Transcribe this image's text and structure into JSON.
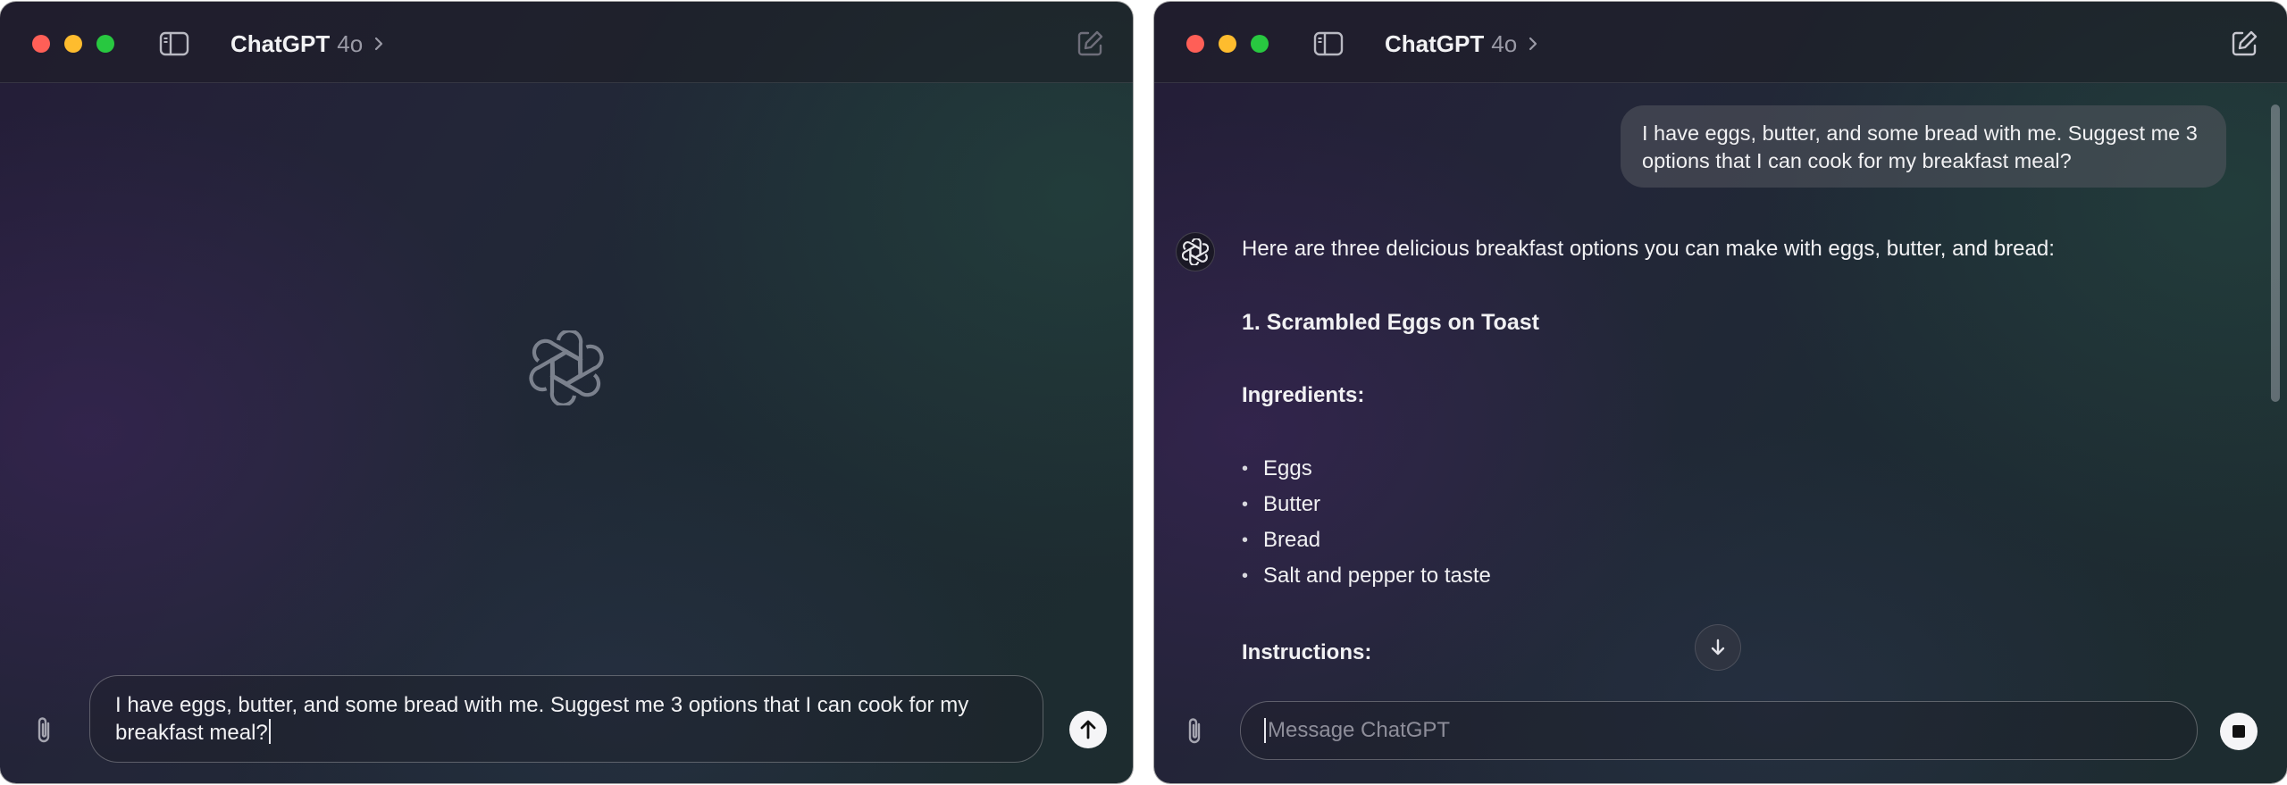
{
  "left_window": {
    "title": "ChatGPT",
    "model": "4o",
    "composer_text": "I have eggs, butter, and some bread with me. Suggest me 3 options that I can cook for my breakfast meal?",
    "icons": {
      "sidebar": "sidebar-toggle-icon",
      "new_chat": "compose-icon",
      "logo": "openai-logo-icon",
      "attach": "paperclip-icon",
      "send": "arrow-up-icon"
    }
  },
  "right_window": {
    "title": "ChatGPT",
    "model": "4o",
    "user_message": "I have eggs, butter, and some bread with me. Suggest me 3 options that I can cook for my breakfast meal?",
    "assistant": {
      "intro": "Here are three delicious breakfast options you can make with eggs, butter, and bread:",
      "heading": "1. Scrambled Eggs on Toast",
      "ingredients_label": "Ingredients:",
      "ingredients": [
        "Eggs",
        "Butter",
        "Bread",
        "Salt and pepper to taste"
      ],
      "instructions_label": "Instructions:"
    },
    "composer_placeholder": "Message ChatGPT",
    "icons": {
      "scroll_down": "arrow-down-icon",
      "stop": "stop-icon"
    }
  },
  "colors": {
    "close": "#ff5f57",
    "minimize": "#febc2e",
    "zoom": "#28c840"
  }
}
